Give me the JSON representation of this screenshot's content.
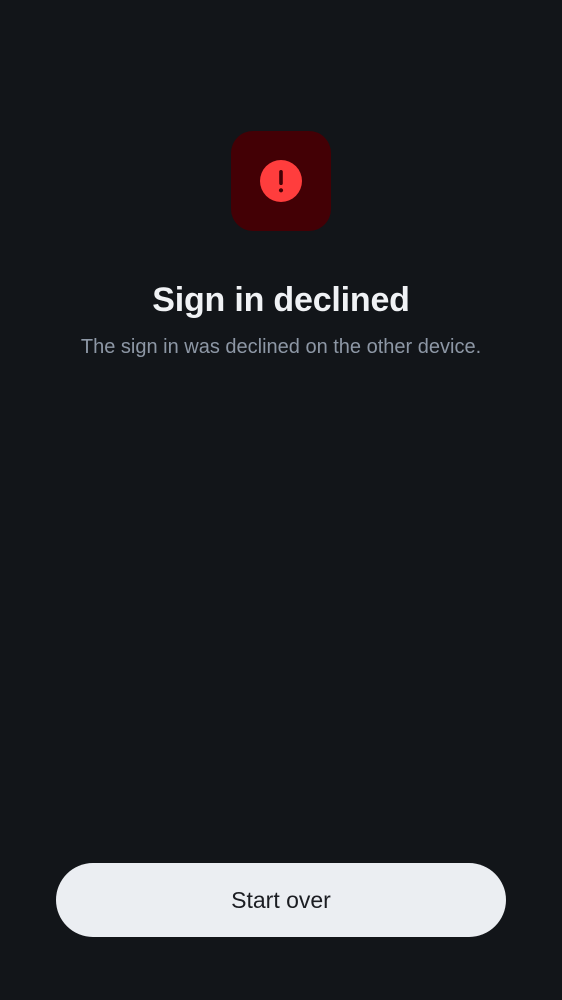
{
  "status": {
    "icon": "alert-circle-icon",
    "title": "Sign in declined",
    "message": "The sign in was declined on the other device."
  },
  "actions": {
    "start_over_label": "Start over"
  },
  "colors": {
    "background": "#121519",
    "icon_tile": "#430005",
    "icon": "#ff3d3d",
    "title_text": "#f0f2f5",
    "message_text": "#8d97a5",
    "button_background": "#ebeef2",
    "button_text": "#1b1d22"
  }
}
